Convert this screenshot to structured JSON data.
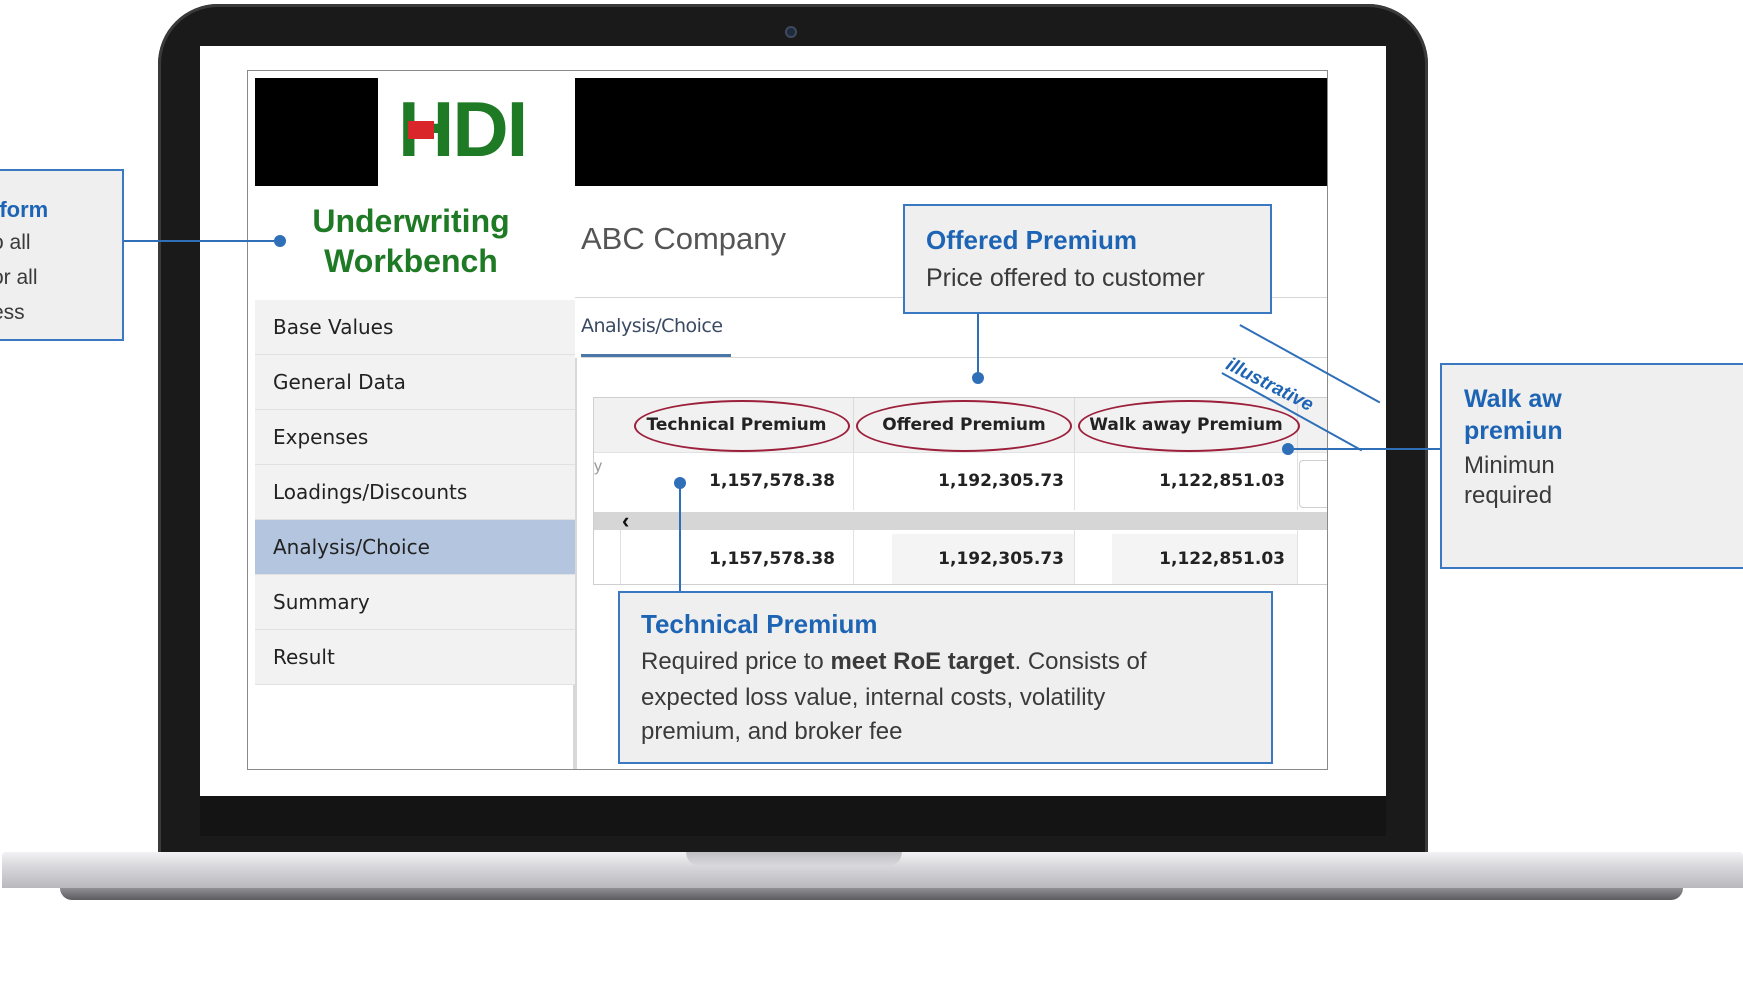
{
  "app": {
    "logo_text": "HDI",
    "workbench_title_line1": "Underwriting",
    "workbench_title_line2": "Workbench",
    "company_name": "ABC Company",
    "active_tab": "Analysis/Choice"
  },
  "sidebar": {
    "items": [
      {
        "label": "Base Values"
      },
      {
        "label": "General Data"
      },
      {
        "label": "Expenses"
      },
      {
        "label": "Loadings/Discounts"
      },
      {
        "label": "Analysis/Choice",
        "active": true
      },
      {
        "label": "Summary"
      },
      {
        "label": "Result"
      }
    ]
  },
  "grid": {
    "headers": [
      "Technical Premium",
      "Offered Premium",
      "Walk away Premium"
    ],
    "rows": [
      [
        "1,157,578.38",
        "1,192,305.73",
        "1,122,851.03"
      ],
      [
        "1,157,578.38",
        "1,192,305.73",
        "1,122,851.03"
      ]
    ],
    "scroll_left_glyph": "‹",
    "first_col_fragment": "y"
  },
  "annotations": {
    "illustrative": "illustrative",
    "platform": {
      "title": "tform",
      "lines": [
        "o all",
        "or all",
        "ess"
      ]
    },
    "offered": {
      "title": "Offered Premium",
      "text": "Price offered to customer"
    },
    "walkaway": {
      "title_line1": "Walk aw",
      "title_line2": "premiun",
      "text_line1": "Minimun",
      "text_line2": "required"
    },
    "technical": {
      "title": "Technical Premium",
      "text_pre": "Required price to ",
      "text_bold": "meet RoE target",
      "text_post": ". Consists of",
      "line2": "expected loss value, internal costs, volatility",
      "line3": "premium, and broker fee"
    }
  },
  "colors": {
    "hdi_green": "#1e7a24",
    "hdi_red": "#d9262b",
    "annotation_blue": "#1e64b4",
    "oval_red": "#9c1f3b",
    "active_nav": "#b4c6df"
  }
}
